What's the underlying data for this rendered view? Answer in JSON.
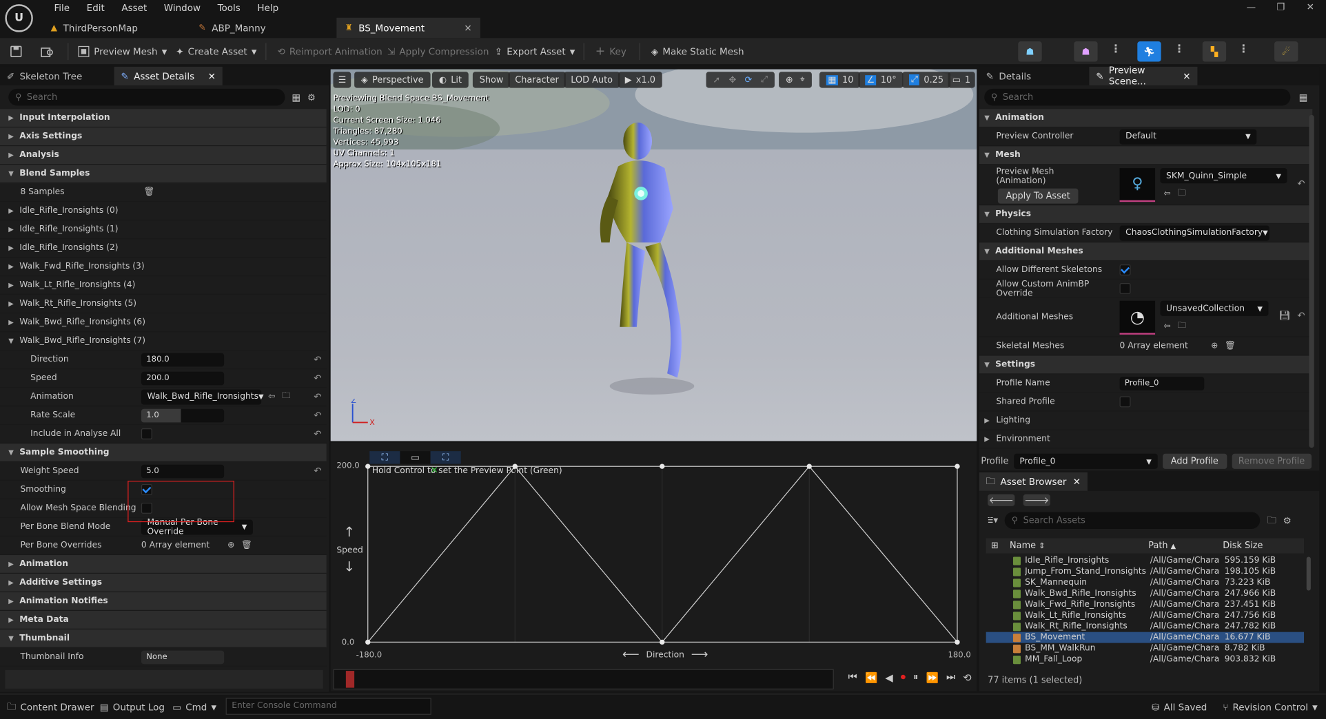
{
  "menu": [
    "File",
    "Edit",
    "Asset",
    "Window",
    "Tools",
    "Help"
  ],
  "tabs": [
    {
      "label": "ThirdPersonMap"
    },
    {
      "label": "ABP_Manny"
    },
    {
      "label": "BS_Movement"
    }
  ],
  "toolbar": {
    "save": "",
    "preview_mesh": "Preview Mesh",
    "create_asset": "Create Asset",
    "reimport": "Reimport Animation",
    "apply_compression": "Apply Compression",
    "export_asset": "Export Asset",
    "key": "Key",
    "make_static_mesh": "Make Static Mesh"
  },
  "left_tabs": {
    "skeleton_tree": "Skeleton Tree",
    "asset_details": "Asset Details"
  },
  "left_search_placeholder": "Search",
  "details_left": {
    "input_interpolation": "Input Interpolation",
    "axis_settings": "Axis Settings",
    "analysis": "Analysis",
    "blend_samples": "Blend Samples",
    "samples_count": "8 Samples",
    "samples": [
      "Idle_Rifle_Ironsights (0)",
      "Idle_Rifle_Ironsights (1)",
      "Idle_Rifle_Ironsights (2)",
      "Walk_Fwd_Rifle_Ironsights (3)",
      "Walk_Lt_Rifle_Ironsights (4)",
      "Walk_Rt_Rifle_Ironsights (5)",
      "Walk_Bwd_Rifle_Ironsights (6)",
      "Walk_Bwd_Rifle_Ironsights (7)"
    ],
    "direction_label": "Direction",
    "direction_value": "180.0",
    "speed_label": "Speed",
    "speed_value": "200.0",
    "animation_label": "Animation",
    "animation_value": "Walk_Bwd_Rifle_Ironsights",
    "rate_scale_label": "Rate Scale",
    "rate_scale_value": "1.0",
    "include_label": "Include in Analyse All",
    "sample_smoothing": "Sample Smoothing",
    "weight_speed_label": "Weight Speed",
    "weight_speed_value": "5.0",
    "smoothing_label": "Smoothing",
    "allow_mesh_label": "Allow Mesh Space Blending",
    "per_bone_mode_label": "Per Bone Blend Mode",
    "per_bone_mode_value": "Manual Per Bone Override",
    "per_bone_overrides_label": "Per Bone Overrides",
    "per_bone_overrides_value": "0 Array element",
    "animation_cat": "Animation",
    "additive": "Additive Settings",
    "notifies": "Animation Notifies",
    "meta": "Meta Data",
    "thumbnail": "Thumbnail",
    "thumbnail_info_label": "Thumbnail Info",
    "thumbnail_info_value": "None"
  },
  "viewport": {
    "perspective": "Perspective",
    "lit": "Lit",
    "show": "Show",
    "character": "Character",
    "lod": "LOD Auto",
    "speed": "x1.0",
    "grid": "10",
    "angle": "10°",
    "scale": "0.25",
    "camera": "1",
    "stats": [
      "Previewing Blend Space BS_Movement",
      "LOD: 0",
      "Current Screen Size: 1.046",
      "Triangles: 87,280",
      "Vertices: 45,993",
      "UV Channels: 1",
      "Approx Size: 104x105x181"
    ]
  },
  "graph": {
    "hint": "Hold Control to set the Preview Point (Green)",
    "y_label": "Speed",
    "x_label": "Direction",
    "y_max": "200.0",
    "y_min": "0.0",
    "x_min": "-180.0",
    "x_max": "180.0"
  },
  "right_tabs": {
    "details": "Details",
    "preview_scene": "Preview Scene..."
  },
  "right_search_placeholder": "Search",
  "details_right": {
    "animation_cat": "Animation",
    "preview_controller_label": "Preview Controller",
    "preview_controller_value": "Default",
    "mesh_cat": "Mesh",
    "preview_mesh_label1": "Preview Mesh",
    "preview_mesh_label2": "(Animation)",
    "preview_mesh_value": "SKM_Quinn_Simple",
    "apply_to_asset": "Apply To Asset",
    "physics_cat": "Physics",
    "clothing_label": "Clothing Simulation Factory",
    "clothing_value": "ChaosClothingSimulationFactory",
    "additional_cat": "Additional Meshes",
    "allow_diff_label": "Allow Different Skeletons",
    "allow_custom_label": "Allow Custom AnimBP Override",
    "additional_label": "Additional Meshes",
    "additional_value": "UnsavedCollection",
    "skeletal_label": "Skeletal Meshes",
    "skeletal_value": "0 Array element",
    "settings_cat": "Settings",
    "profile_name_label": "Profile Name",
    "profile_name_value": "Profile_0",
    "shared_label": "Shared Profile",
    "lighting": "Lighting",
    "environment": "Environment",
    "profile_label": "Profile",
    "profile_value": "Profile_0",
    "add_profile": "Add Profile",
    "remove_profile": "Remove Profile"
  },
  "asset_browser": {
    "tab": "Asset Browser",
    "search_placeholder": "Search Assets",
    "col_name": "Name",
    "col_path": "Path",
    "col_size": "Disk Size",
    "status": "77 items (1 selected)",
    "rows": [
      {
        "name": "Idle_Rifle_Ironsights",
        "path": "/All/Game/Chara",
        "size": "595.159 KiB"
      },
      {
        "name": "Jump_From_Stand_Ironsights",
        "path": "/All/Game/Chara",
        "size": "198.105 KiB"
      },
      {
        "name": "SK_Mannequin",
        "path": "/All/Game/Chara",
        "size": "73.223 KiB"
      },
      {
        "name": "Walk_Bwd_Rifle_Ironsights",
        "path": "/All/Game/Chara",
        "size": "247.966 KiB"
      },
      {
        "name": "Walk_Fwd_Rifle_Ironsights",
        "path": "/All/Game/Chara",
        "size": "237.451 KiB"
      },
      {
        "name": "Walk_Lt_Rifle_Ironsights",
        "path": "/All/Game/Chara",
        "size": "247.756 KiB"
      },
      {
        "name": "Walk_Rt_Rifle_Ironsights",
        "path": "/All/Game/Chara",
        "size": "247.782 KiB"
      },
      {
        "name": "BS_Movement",
        "path": "/All/Game/Chara",
        "size": "16.677 KiB"
      },
      {
        "name": "BS_MM_WalkRun",
        "path": "/All/Game/Chara",
        "size": "8.782 KiB"
      },
      {
        "name": "MM_Fall_Loop",
        "path": "/All/Game/Chara",
        "size": "903.832 KiB"
      }
    ]
  },
  "statusbar": {
    "content_drawer": "Content Drawer",
    "output_log": "Output Log",
    "cmd": "Cmd",
    "console_placeholder": "Enter Console Command",
    "all_saved": "All Saved",
    "revision": "Revision Control"
  },
  "colors": {
    "accent": "#1f7fe0",
    "highlight_box": "#e02020",
    "selected_row": "#2a4f82"
  }
}
